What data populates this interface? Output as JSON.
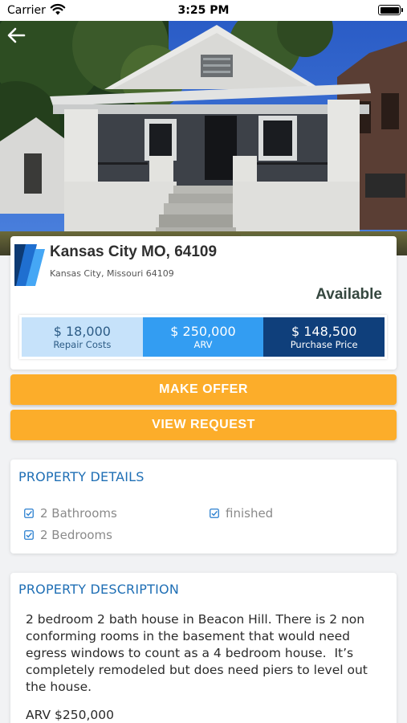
{
  "status_bar": {
    "carrier": "Carrier",
    "time": "3:25 PM"
  },
  "nav": {
    "back_icon": "arrow-left-icon"
  },
  "property": {
    "title": "Kansas City MO, 64109",
    "subtitle": "Kansas City, Missouri 64109",
    "status": "Available"
  },
  "prices": [
    {
      "amount": "$ 18,000",
      "label": "Repair Costs",
      "color": "#c6e2fa"
    },
    {
      "amount": "$ 250,000",
      "label": "ARV",
      "color": "#339df2"
    },
    {
      "amount": "$ 148,500",
      "label": "Purchase Price",
      "color": "#0f3f7b"
    }
  ],
  "actions": {
    "make_offer": "MAKE OFFER",
    "view_request": "VIEW REQUEST",
    "color": "#fcad2a"
  },
  "details": {
    "heading": "PROPERTY DETAILS",
    "items": [
      "2 Bathrooms",
      "finished",
      "2 Bedrooms"
    ],
    "check_icon": "checkbox-checked-icon"
  },
  "description": {
    "heading": "PROPERTY DESCRIPTION",
    "text": "2 bedroom 2 bath house in Beacon Hill. There is 2 non conforming rooms in the basement that would need egress windows to count as a 4 bedroom house.  It’s completely remodeled but does need piers to level out the house.",
    "arv_line": "ARV $250,000"
  },
  "colors": {
    "accent_blue": "#1f6fb5",
    "status_text": "#35473f"
  }
}
